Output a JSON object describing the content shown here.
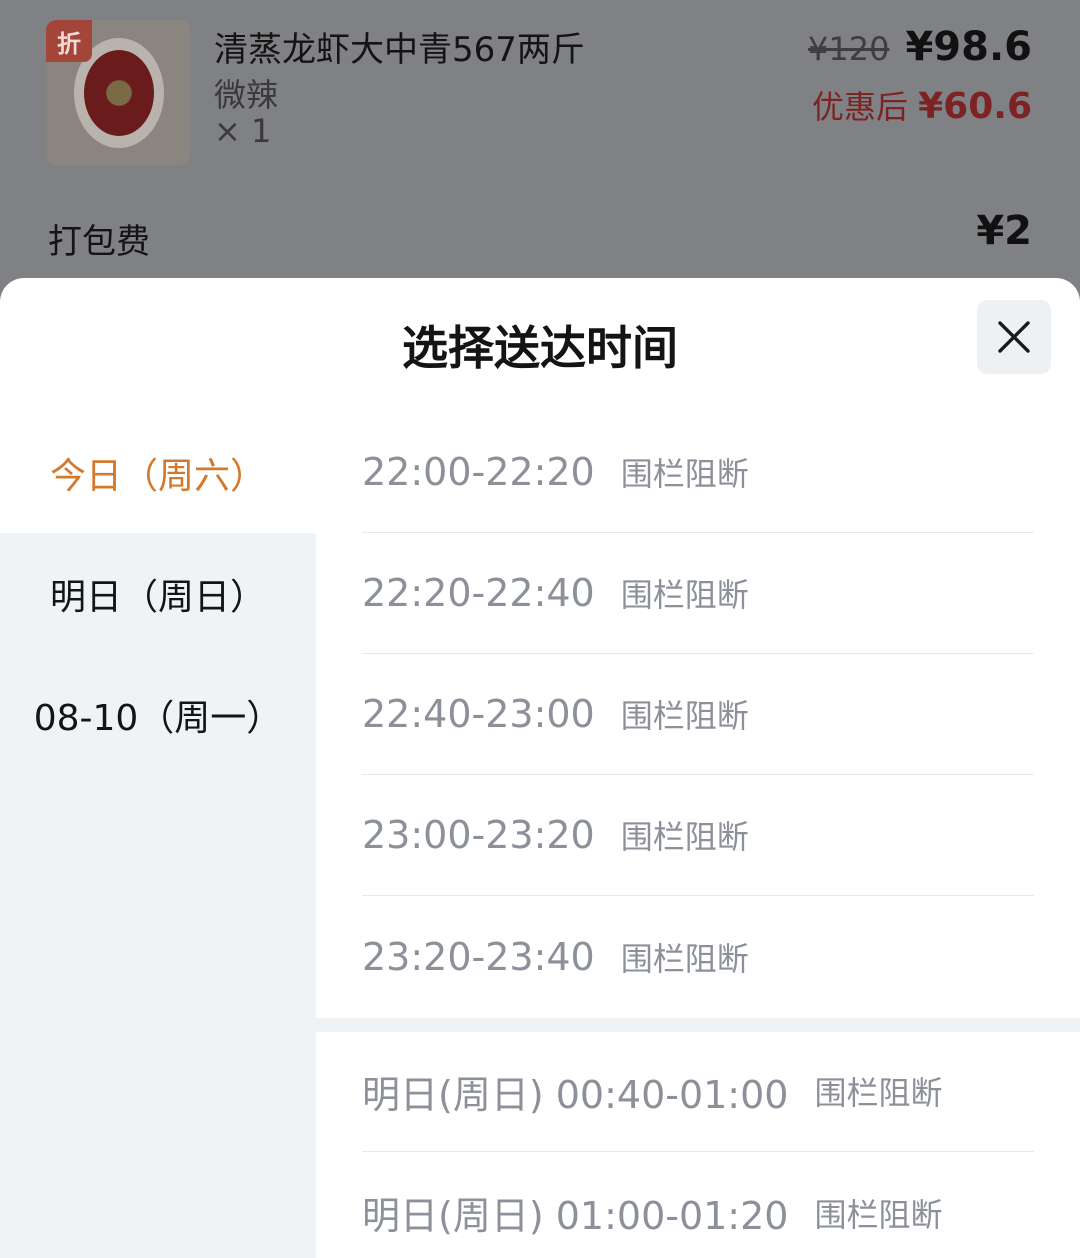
{
  "order": {
    "item": {
      "name": "清蒸龙虾大中青567两斤",
      "spec": "微辣",
      "qty": "× 1",
      "badge": "折",
      "original_price": "¥120",
      "current_price": "¥98.6",
      "after_discount_label": "优惠后",
      "after_discount_price": "¥60.6"
    },
    "packaging": {
      "label": "打包费",
      "price": "¥2"
    }
  },
  "sheet": {
    "title": "选择送达时间",
    "close_icon": "close-icon",
    "dates": [
      {
        "label": "今日（周六）",
        "active": true
      },
      {
        "label": "明日（周日）",
        "active": false
      },
      {
        "label": "08-10（周一）",
        "active": false
      }
    ],
    "slots": [
      {
        "time": "22:00-22:20",
        "status": "围栏阻断"
      },
      {
        "time": "22:20-22:40",
        "status": "围栏阻断"
      },
      {
        "time": "22:40-23:00",
        "status": "围栏阻断"
      },
      {
        "time": "23:00-23:20",
        "status": "围栏阻断"
      },
      {
        "time": "23:20-23:40",
        "status": "围栏阻断"
      }
    ],
    "next_day_slots": [
      {
        "time": "明日(周日) 00:40-01:00",
        "status": "围栏阻断"
      },
      {
        "time": "明日(周日) 01:00-01:20",
        "status": "围栏阻断"
      }
    ]
  },
  "colors": {
    "accent": "#d4792c",
    "disabled_text": "#8c9099",
    "discount_red": "#7d2323"
  }
}
